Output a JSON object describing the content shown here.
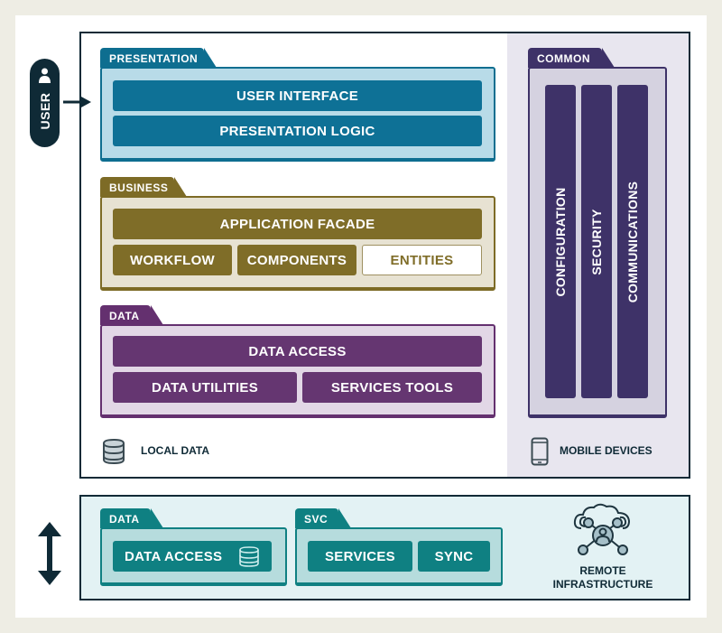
{
  "user": {
    "label": "USER"
  },
  "presentation": {
    "tab": "PRESENTATION",
    "blocks": [
      "USER INTERFACE",
      "PRESENTATION LOGIC"
    ]
  },
  "business": {
    "tab": "BUSINESS",
    "facade": "APPLICATION FACADE",
    "blocks": [
      "WORKFLOW",
      "COMPONENTS",
      "ENTITIES"
    ]
  },
  "data": {
    "tab": "DATA",
    "access": "DATA ACCESS",
    "blocks": [
      "DATA UTILITIES",
      "SERVICES TOOLS"
    ]
  },
  "common": {
    "tab": "COMMON",
    "columns": [
      "CONFIGURATION",
      "SECURITY",
      "COMMUNICATIONS"
    ]
  },
  "captions": {
    "local_data": "LOCAL DATA",
    "mobile_devices": "MOBILE DEVICES"
  },
  "remote": {
    "data_tab": "DATA",
    "data_access": "DATA ACCESS",
    "svc_tab": "SVC",
    "services": "SERVICES",
    "sync": "SYNC",
    "infra_line1": "REMOTE",
    "infra_line2": "INFRASTRUCTURE"
  },
  "colors": {
    "presentation": "#0e7196",
    "business": "#7f6d28",
    "data": "#653671",
    "common": "#3e3268",
    "remote": "#0f8082",
    "outline": "#0f2a36"
  }
}
